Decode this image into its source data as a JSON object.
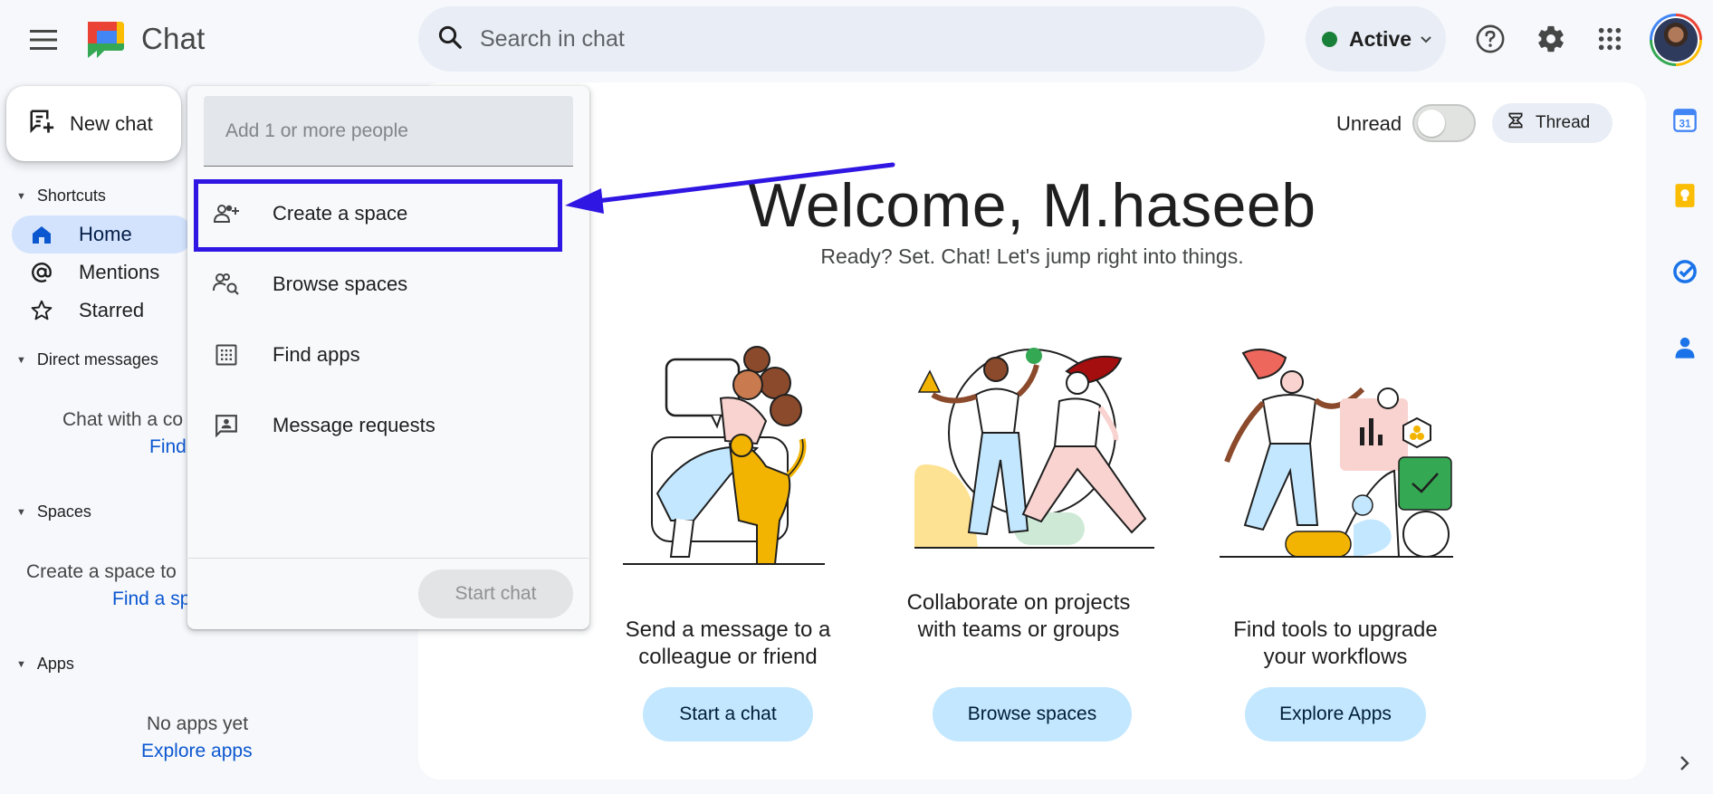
{
  "app": {
    "title": "Chat"
  },
  "search": {
    "placeholder": "Search in chat"
  },
  "status": {
    "label": "Active",
    "color": "#188038"
  },
  "icons": {
    "menu": "hamburger-menu-icon",
    "help": "help-icon",
    "settings": "gear-icon",
    "apps": "apps-grid-icon",
    "search": "search-icon"
  },
  "sidebar": {
    "new_chat_label": "New chat",
    "shortcuts": {
      "header": "Shortcuts",
      "items": [
        {
          "label": "Home",
          "icon": "home-icon",
          "active": true
        },
        {
          "label": "Mentions",
          "icon": "at-icon"
        },
        {
          "label": "Starred",
          "icon": "star-icon"
        }
      ]
    },
    "direct_messages": {
      "header": "Direct messages",
      "text": "Chat with a co",
      "link": "Find"
    },
    "spaces": {
      "header": "Spaces",
      "text": "Create a space to",
      "link": "Find a sp"
    },
    "apps": {
      "header": "Apps",
      "text": "No apps yet",
      "link": "Explore apps"
    }
  },
  "dropdown": {
    "input_placeholder": "Add 1 or more people",
    "items": [
      {
        "label": "Create a space",
        "icon": "group-add-icon"
      },
      {
        "label": "Browse spaces",
        "icon": "people-search-icon"
      },
      {
        "label": "Find apps",
        "icon": "apps-grid-icon"
      },
      {
        "label": "Message requests",
        "icon": "person-message-icon"
      }
    ],
    "start_chat_label": "Start chat"
  },
  "main": {
    "unread_label": "Unread",
    "unread_on": false,
    "thread_label": "Thread",
    "welcome": "Welcome, M.haseeb",
    "subtitle": "Ready? Set. Chat! Let's jump right into things.",
    "cards": [
      {
        "text": "Send a message to a colleague or friend",
        "button": "Start a chat"
      },
      {
        "text": "Collaborate on projects with teams or groups",
        "button": "Browse spaces"
      },
      {
        "text": "Find tools to upgrade your workflows",
        "button": "Explore Apps"
      }
    ]
  },
  "rail": {
    "icons": [
      "calendar-icon",
      "keep-icon",
      "tasks-icon",
      "contacts-icon"
    ],
    "calendar_day": "31",
    "expand_icon": "chevron-right-icon"
  },
  "annotation": {
    "color": "#2f16e2"
  }
}
